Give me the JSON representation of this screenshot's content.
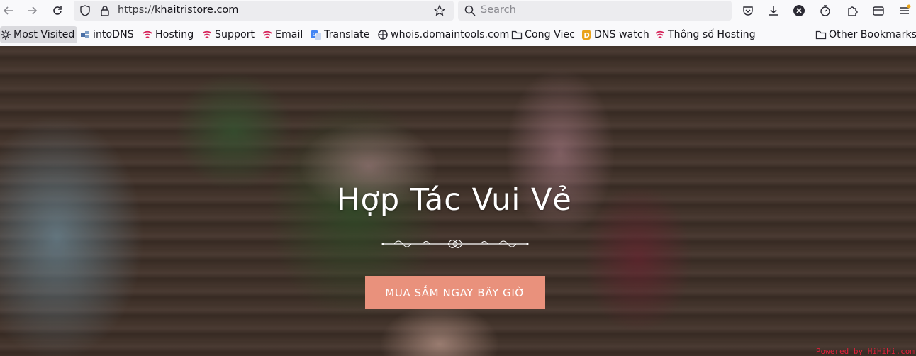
{
  "toolbar": {
    "url_prefix": "https://",
    "url_host": "khaitristore.com",
    "search_placeholder": "Search"
  },
  "bookmarks": [
    {
      "label": "Most Visited",
      "icon": "gear-icon"
    },
    {
      "label": "intoDNS",
      "icon": "intodns-icon"
    },
    {
      "label": "Hosting",
      "icon": "hosting-icon"
    },
    {
      "label": "Support",
      "icon": "support-icon"
    },
    {
      "label": "Email",
      "icon": "email-icon"
    },
    {
      "label": "Translate",
      "icon": "translate-icon"
    },
    {
      "label": "whois.domaintools.com",
      "icon": "domaintools-icon"
    },
    {
      "label": "Cong Viec",
      "icon": "folder-icon"
    },
    {
      "label": "DNS watch",
      "icon": "dnswatch-icon"
    },
    {
      "label": "Thông số Hosting",
      "icon": "hosting-icon"
    },
    {
      "label": "Other Bookmarks",
      "icon": "folder-icon"
    }
  ],
  "hero": {
    "title": "Hợp Tác Vui Vẻ",
    "cta_label": "MUA SẮM NGAY BÂY GIỜ",
    "powered_by": "Powered by HiHiHi.com"
  },
  "colors": {
    "cta_background": "#e9917c",
    "toolbar_background": "#f9f9fb",
    "field_background": "#ececef"
  }
}
